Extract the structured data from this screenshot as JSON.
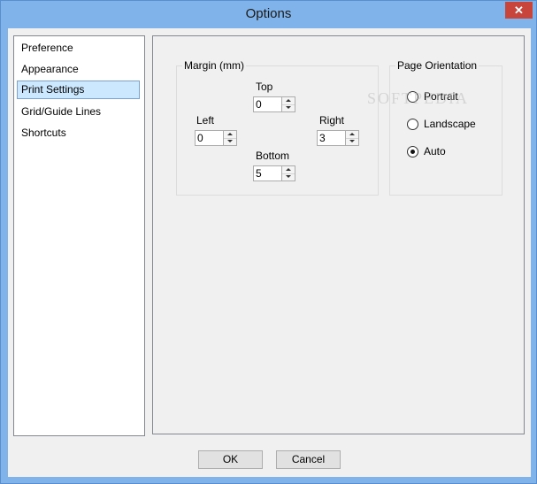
{
  "window": {
    "title": "Options",
    "close_glyph": "✕"
  },
  "nav": {
    "items": [
      {
        "label": "Preference",
        "selected": false
      },
      {
        "label": "Appearance",
        "selected": false
      },
      {
        "label": "Print Settings",
        "selected": true
      },
      {
        "label": "Grid/Guide Lines",
        "selected": false
      },
      {
        "label": "Shortcuts",
        "selected": false
      }
    ]
  },
  "margin": {
    "group_label": "Margin (mm)",
    "top": {
      "label": "Top",
      "value": "0"
    },
    "left": {
      "label": "Left",
      "value": "0"
    },
    "right": {
      "label": "Right",
      "value": "3"
    },
    "bottom": {
      "label": "Bottom",
      "value": "5"
    }
  },
  "orientation": {
    "group_label": "Page Orientation",
    "options": [
      {
        "label": "Portrait",
        "selected": false
      },
      {
        "label": "Landscape",
        "selected": false
      },
      {
        "label": "Auto",
        "selected": true
      }
    ]
  },
  "buttons": {
    "ok": "OK",
    "cancel": "Cancel"
  },
  "watermark": "SOFTPEDIA"
}
